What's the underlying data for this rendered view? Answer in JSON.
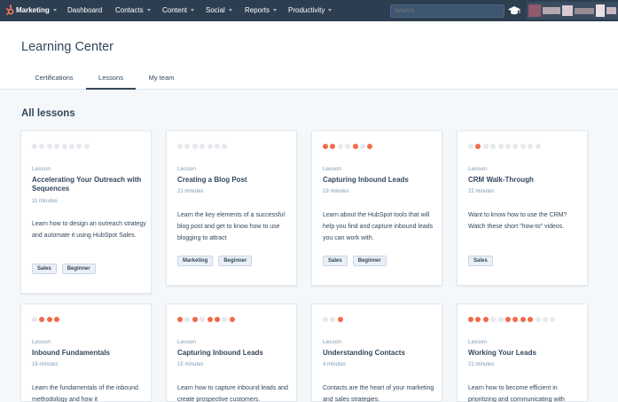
{
  "topnav": {
    "items": [
      "Marketing",
      "Dashboard",
      "Contacts",
      "Content",
      "Social",
      "Reports",
      "Productivity"
    ],
    "search_placeholder": "Search"
  },
  "header": {
    "title": "Learning Center",
    "tabs": [
      "Certifications",
      "Lessons",
      "My team"
    ],
    "active_tab": "Lessons"
  },
  "section_title": "All lessons",
  "colors": {
    "accent": "#f26a4b",
    "nav": "#2d3e50"
  },
  "cards": [
    {
      "label": "Lesson",
      "title": "Accelerating Your Outreach with Sequences",
      "duration": "11 minutes",
      "description": "Learn how to design an outreach strategy and automate it using HubSpot Sales.",
      "tags": [
        "Sales",
        "Beginner"
      ],
      "progress": [
        0,
        0,
        0,
        0,
        0,
        0,
        0,
        0
      ]
    },
    {
      "label": "Lesson",
      "title": "Creating a Blog Post",
      "duration": "21 minutes",
      "description": "Learn the key elements of a successful blog post and get to know how to use blogging to attract",
      "tags": [
        "Marketing",
        "Beginner"
      ],
      "progress": [
        0,
        0,
        0,
        0,
        0,
        0,
        0
      ]
    },
    {
      "label": "Lesson",
      "title": "Capturing Inbound Leads",
      "duration": "19 minutes",
      "description": "Learn about the HubSpot tools that will help you find and capture inbound leads you can work with.",
      "tags": [
        "Sales",
        "Beginner"
      ],
      "progress": [
        1,
        1,
        0,
        0,
        1,
        0,
        1
      ]
    },
    {
      "label": "Lesson",
      "title": "CRM Walk-Through",
      "duration": "22 minutes",
      "description": "Want to know how to use the CRM? Watch these short \"how-to\" videos.",
      "tags": [
        "Sales"
      ],
      "progress": [
        0,
        1,
        0,
        0,
        0,
        0,
        0,
        0,
        0,
        0
      ]
    },
    {
      "label": "Lesson",
      "title": "Inbound Fundamentals",
      "duration": "16 minutes",
      "description": "Learn the fundamentals of the inbound methodology and how it",
      "tags": [],
      "progress": [
        0,
        1,
        1,
        1
      ]
    },
    {
      "label": "Lesson",
      "title": "Capturing Inbound Leads",
      "duration": "15 minutes",
      "description": "Learn how to capture inbound leads and create prospective customers.",
      "tags": [],
      "progress": [
        1,
        0,
        1,
        0,
        1,
        1,
        0,
        1
      ]
    },
    {
      "label": "Lesson",
      "title": "Understanding Contacts",
      "duration": "4 minutes",
      "description": "Contacts are the heart of your marketing and sales strategies.",
      "tags": [],
      "progress": [
        0,
        0,
        1
      ]
    },
    {
      "label": "Lesson",
      "title": "Working Your Leads",
      "duration": "21 minutes",
      "description": "Learn how to become efficient in prioritizing and communicating with",
      "tags": [],
      "progress": [
        1,
        1,
        1,
        0,
        0,
        1,
        1,
        1,
        1,
        0,
        0,
        0
      ]
    }
  ]
}
